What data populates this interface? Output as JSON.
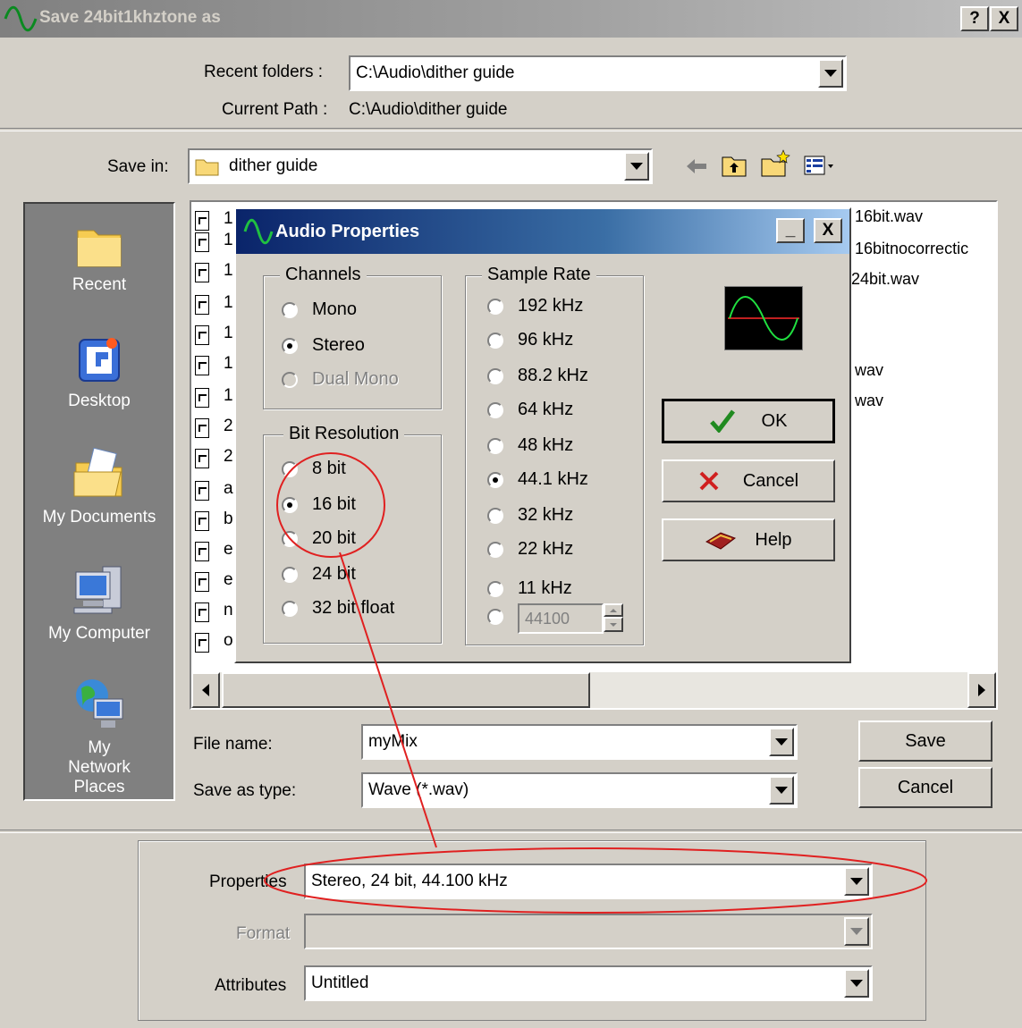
{
  "window": {
    "title": "Save 24bit1khztone as",
    "help_button": "?",
    "close_button": "X"
  },
  "top": {
    "recent_folders_label": "Recent folders :",
    "recent_folders_value": "C:\\Audio\\dither guide",
    "current_path_label": "Current Path :",
    "current_path_value": "C:\\Audio\\dither guide"
  },
  "save_in": {
    "label": "Save in:",
    "value": "dither guide",
    "toolbar_icons": [
      "back-arrow-icon",
      "up-folder-icon",
      "new-folder-icon",
      "view-menu-icon"
    ]
  },
  "places": [
    {
      "label": "Recent",
      "icon": "recent-folder-icon"
    },
    {
      "label": "Desktop",
      "icon": "desktop-icon"
    },
    {
      "label": "My Documents",
      "icon": "my-documents-icon"
    },
    {
      "label": "My Computer",
      "icon": "my-computer-icon"
    },
    {
      "label": "My Network Places",
      "icon": "network-places-icon"
    }
  ],
  "files_left": [
    "1",
    "1",
    "1",
    "1",
    "1",
    "1",
    "1",
    "2",
    "2",
    "a",
    "b",
    "e",
    "e",
    "n",
    "o"
  ],
  "files_right": [
    "16bit.wav",
    "16bitnocorrectic",
    "24bit.wav",
    "wav",
    "wav"
  ],
  "file_name": {
    "label": "File name:",
    "value": "myMix"
  },
  "save_as_type": {
    "label": "Save as type:",
    "value": "Wave (*.wav)"
  },
  "buttons": {
    "save": "Save",
    "cancel": "Cancel"
  },
  "bottom": {
    "properties_label": "Properties",
    "properties_value": "Stereo, 24 bit, 44.100 kHz",
    "format_label": "Format",
    "format_value": "",
    "attributes_label": "Attributes",
    "attributes_value": "Untitled"
  },
  "audio_properties": {
    "title": "Audio Properties",
    "minimize": "_",
    "close": "X",
    "channels": {
      "legend": "Channels",
      "options": [
        {
          "label": "Mono",
          "selected": false,
          "enabled": true
        },
        {
          "label": "Stereo",
          "selected": true,
          "enabled": true
        },
        {
          "label": "Dual Mono",
          "selected": false,
          "enabled": false
        }
      ]
    },
    "bit_resolution": {
      "legend": "Bit Resolution",
      "options": [
        {
          "label": "8 bit",
          "selected": false
        },
        {
          "label": "16 bit",
          "selected": true
        },
        {
          "label": "20 bit",
          "selected": false
        },
        {
          "label": "24 bit",
          "selected": false
        },
        {
          "label": "32 bit float",
          "selected": false
        }
      ]
    },
    "sample_rate": {
      "legend": "Sample Rate",
      "options": [
        {
          "label": "192 kHz",
          "selected": false
        },
        {
          "label": "96 kHz",
          "selected": false
        },
        {
          "label": "88.2 kHz",
          "selected": false
        },
        {
          "label": "64 kHz",
          "selected": false
        },
        {
          "label": "48 kHz",
          "selected": false
        },
        {
          "label": "44.1 kHz",
          "selected": true
        },
        {
          "label": "32 kHz",
          "selected": false
        },
        {
          "label": "22 kHz",
          "selected": false
        },
        {
          "label": "11 kHz",
          "selected": false
        }
      ],
      "custom_value": "44100"
    },
    "ok": "OK",
    "cancel": "Cancel",
    "help": "Help"
  },
  "colors": {
    "annotation": "#e02020",
    "face": "#d4d0c8",
    "title_active": "#0a246a"
  }
}
